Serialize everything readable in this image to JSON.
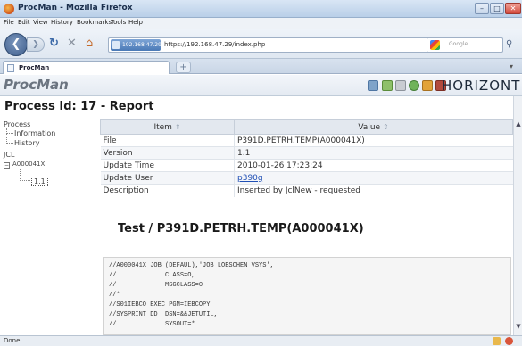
{
  "window": {
    "title": "ProcMan - Mozilla Firefox"
  },
  "menu": [
    "File",
    "Edit",
    "View",
    "History",
    "Bookmarks",
    "Tools",
    "Help"
  ],
  "nav": {
    "site_badge": "192.168.47.29",
    "url": "https://192.168.47.29/index.php",
    "search_placeholder": "Google"
  },
  "tab": {
    "label": "ProcMan",
    "new_tab": "+"
  },
  "header": {
    "logo": "ProcMan",
    "brand": "HORIZONT"
  },
  "page": {
    "heading": "Process Id: 17 - Report"
  },
  "tree": {
    "process": "Process",
    "information": "Information",
    "history": "History",
    "jcl": "JCL",
    "job": "A000041X",
    "version": "1.1"
  },
  "table": {
    "col_item": "Item",
    "col_value": "Value",
    "sort_glyph": "⇕",
    "rows": [
      {
        "key": "File",
        "value": "P391D.PETRH.TEMP(A000041X)"
      },
      {
        "key": "Version",
        "value": "1.1"
      },
      {
        "key": "Update Time",
        "value": "2010-01-26 17:23:24"
      },
      {
        "key": "Update User",
        "value": "p390g"
      },
      {
        "key": "Description",
        "value": "Inserted by JclNew - requested"
      }
    ]
  },
  "section": {
    "heading": "Test / P391D.PETRH.TEMP(A000041X)"
  },
  "code": {
    "lines": [
      "//A000041X JOB (DEFAUL),'JOB LOESCHEN VSYS',",
      "//             CLASS=O,",
      "//             MSGCLASS=0",
      "//*",
      "//S01IEBCO EXEC PGM=IEBCOPY",
      "//SYSPRINT DD  DSN=&&JETUTIL,",
      "//             SYSOUT=*"
    ]
  },
  "status": {
    "text": "Done"
  },
  "colors": {
    "link": "#1f4fb5",
    "header_bg": "#e4eaf2",
    "title_bar": "#b9cfe8"
  }
}
